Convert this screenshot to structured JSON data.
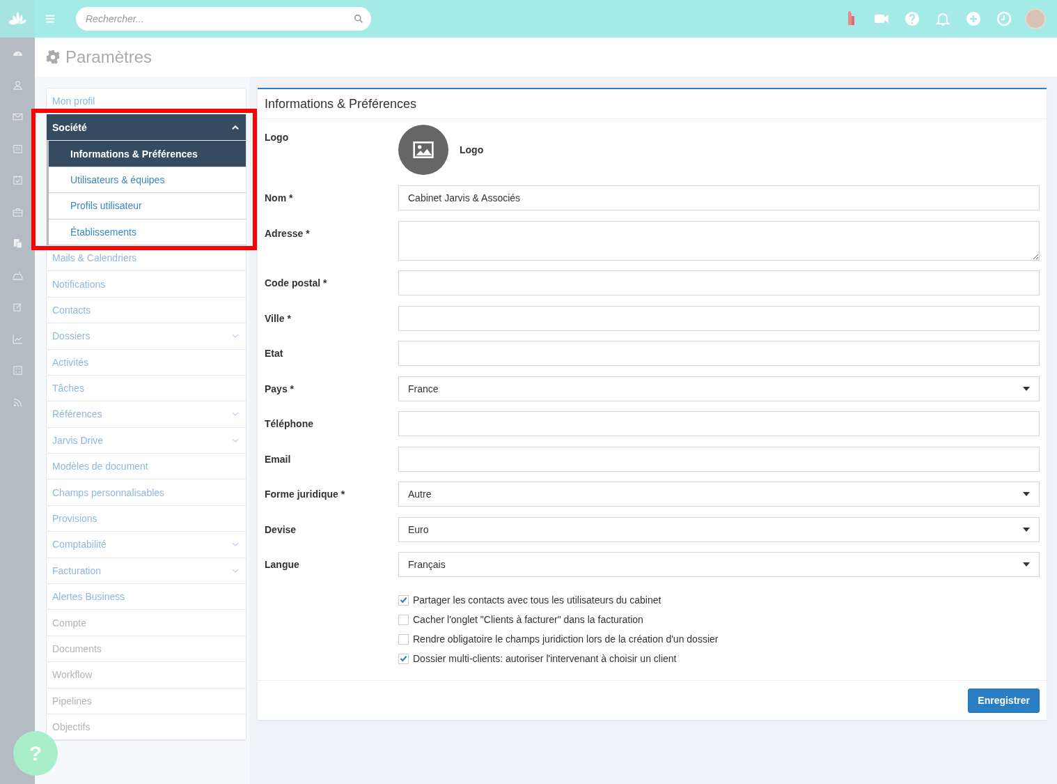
{
  "topbar": {
    "search": {
      "placeholder": "Rechercher..."
    }
  },
  "page_title": "Paramètres",
  "settings_menu": [
    {
      "label": "Mon profil",
      "kind": "link",
      "disabled": false
    },
    {
      "label": "Société",
      "kind": "group",
      "expanded": true,
      "children": [
        {
          "label": "Informations & Préférences",
          "selected": true
        },
        {
          "label": "Utilisateurs & équipes",
          "selected": false
        },
        {
          "label": "Profils utilisateur",
          "selected": false
        },
        {
          "label": "Établissements",
          "selected": false
        }
      ]
    },
    {
      "label": "Mails & Calendriers",
      "kind": "link",
      "disabled": false
    },
    {
      "label": "Notifications",
      "kind": "link",
      "disabled": false
    },
    {
      "label": "Contacts",
      "kind": "link",
      "disabled": false
    },
    {
      "label": "Dossiers",
      "kind": "group",
      "expanded": false
    },
    {
      "label": "Activités",
      "kind": "link",
      "disabled": false
    },
    {
      "label": "Tâches",
      "kind": "link",
      "disabled": false
    },
    {
      "label": "Références",
      "kind": "group",
      "expanded": false
    },
    {
      "label": "Jarvis Drive",
      "kind": "group",
      "expanded": false
    },
    {
      "label": "Modèles de document",
      "kind": "link",
      "disabled": false
    },
    {
      "label": "Champs personnalisables",
      "kind": "link",
      "disabled": false
    },
    {
      "label": "Provisions",
      "kind": "link",
      "disabled": false
    },
    {
      "label": "Comptabilité",
      "kind": "group",
      "expanded": false
    },
    {
      "label": "Facturation",
      "kind": "group",
      "expanded": false
    },
    {
      "label": "Alertes Business",
      "kind": "link",
      "disabled": false
    },
    {
      "label": "Compte",
      "kind": "link",
      "disabled": true
    },
    {
      "label": "Documents",
      "kind": "link",
      "disabled": true
    },
    {
      "label": "Workflow",
      "kind": "link",
      "disabled": true
    },
    {
      "label": "Pipelines",
      "kind": "link",
      "disabled": true
    },
    {
      "label": "Objectifs",
      "kind": "link",
      "disabled": true
    }
  ],
  "panel": {
    "title": "Informations & Préférences",
    "logo": {
      "label": "Logo",
      "caption": "Logo"
    },
    "fields": [
      {
        "label": "Nom *",
        "kind": "text",
        "value": "Cabinet Jarvis & Associés"
      },
      {
        "label": "Adresse *",
        "kind": "textarea"
      },
      {
        "label": "Code postal *",
        "kind": "text"
      },
      {
        "label": "Ville *",
        "kind": "text"
      },
      {
        "label": "Etat",
        "kind": "text"
      },
      {
        "label": "Pays *",
        "kind": "select",
        "value": "France"
      },
      {
        "label": "Téléphone",
        "kind": "text"
      },
      {
        "label": "Email",
        "kind": "text"
      },
      {
        "label": "Forme juridique *",
        "kind": "select",
        "value": "Autre"
      },
      {
        "label": "Devise",
        "kind": "select",
        "value": "Euro"
      },
      {
        "label": "Langue",
        "kind": "select",
        "value": "Français"
      }
    ],
    "options": [
      {
        "label": "Partager les contacts avec tous les utilisateurs du cabinet",
        "checked": true
      },
      {
        "label": "Cacher l'onglet \"Clients à facturer\" dans la facturation",
        "checked": false
      },
      {
        "label": "Rendre obligatoire le champs juridiction lors de la création d'un dossier",
        "checked": false
      },
      {
        "label": "Dossier multi-clients: autoriser l'intervenant à choisir un client",
        "checked": true
      }
    ],
    "save_button": "Enregistrer"
  },
  "help_button": "?"
}
